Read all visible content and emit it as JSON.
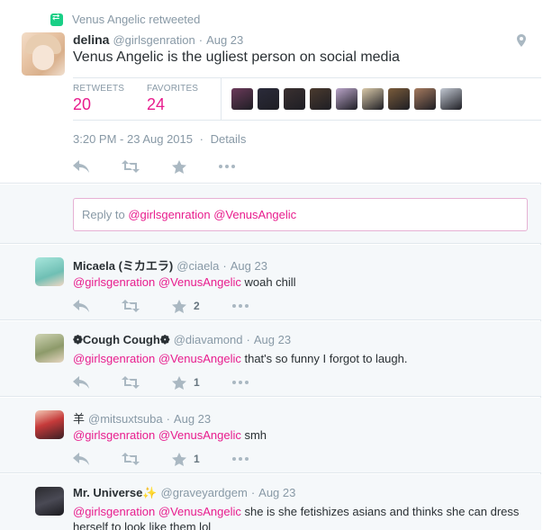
{
  "main_tweet": {
    "retweet_label": "Venus Angelic retweeted",
    "author_name": "delina",
    "handle": "@girlsgenration",
    "dot": "·",
    "date": "Aug 23",
    "text": "Venus Angelic is the ugliest person on social media",
    "stats": {
      "retweets_label": "RETWEETS",
      "retweets": "20",
      "favorites_label": "FAVORITES",
      "favorites": "24"
    },
    "timestamp": "3:20 PM - 23 Aug 2015",
    "details_label": "Details",
    "favoriter_avatar_colors": [
      "#6b3a5a",
      "#2b2b3a",
      "#3a3030",
      "#4a3a2e",
      "#b9a4c8",
      "#d9c9a9",
      "#7a5b3a",
      "#a57a5e",
      "#c2c8d2"
    ]
  },
  "reply_box": {
    "prefix": "Reply to ",
    "mention1": "@girlsgenration",
    "mention2": "@VenusAngelic"
  },
  "replies": [
    {
      "name": "Micaela (ミカエラ)",
      "handle": "@ciaela",
      "dot": "·",
      "date": "Aug 23",
      "mention1": "@girlsgenration",
      "mention2": "@VenusAngelic",
      "text": " woah chill",
      "fav_count": "2",
      "avatar_color": "#8fd4cc"
    },
    {
      "name": "❁Cough Cough❁",
      "handle": "@diavamond",
      "dot": "·",
      "date": "Aug 23",
      "mention1": "@girlsgenration",
      "mention2": "@VenusAngelic",
      "text": " that's so funny I forgot to laugh.",
      "fav_count": "1",
      "avatar_color": "#8d9a6a"
    },
    {
      "name": "羊",
      "handle": "@mitsuxtsuba",
      "dot": "·",
      "date": "Aug 23",
      "mention1": "@girlsgenration",
      "mention2": "@VenusAngelic",
      "text": " smh",
      "fav_count": "1",
      "avatar_color": "#c53a3a"
    },
    {
      "name": "Mr. Universe✨",
      "handle": "@graveyardgem",
      "dot": "·",
      "date": "Aug 23",
      "mention1": "@girlsgenration",
      "mention2": "@VenusAngelic",
      "text": " she is she fetishizes asians and thinks she can dress herself to look like them lol",
      "fav_count": "",
      "avatar_color": "#2a2a2e"
    }
  ],
  "icons": {
    "reply": "reply-icon",
    "retweet": "retweet-icon",
    "favorite": "star-icon",
    "more": "more-icon",
    "location": "location-pin-icon"
  },
  "colors": {
    "accent_link": "#e81c8d",
    "retweet_green": "#19cf86",
    "muted": "#8899a6",
    "action_icon": "#aab8c2"
  }
}
